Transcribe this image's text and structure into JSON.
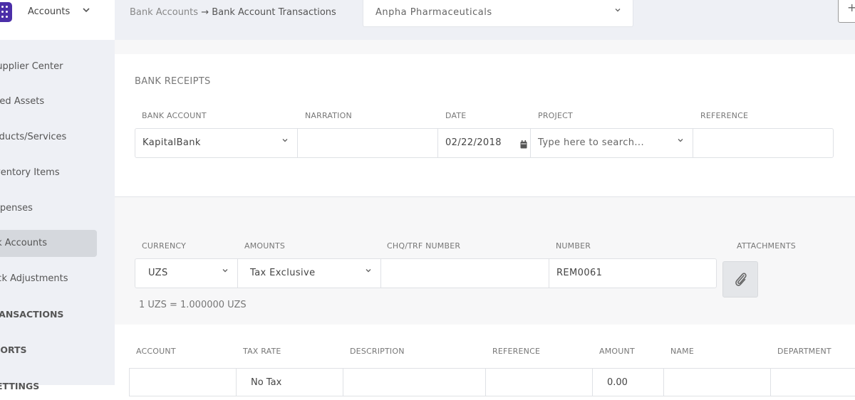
{
  "app": {
    "title": "Accounts"
  },
  "breadcrumb": {
    "parent": "Bank Accounts",
    "separator": "→",
    "current": "Bank Account Transactions"
  },
  "company": {
    "selected": "Anpha Pharmaceuticals"
  },
  "header": {
    "add_label": "+"
  },
  "sidebar": {
    "items": [
      {
        "label": "Supplier Center"
      },
      {
        "label": "Fixed Assets"
      },
      {
        "label": "Products/Services"
      },
      {
        "label": "Inventory Items"
      },
      {
        "label": "Expenses"
      },
      {
        "label": "Bank Accounts"
      },
      {
        "label": "Stock Adjustments"
      }
    ],
    "sections": [
      {
        "label": "TRANSACTIONS"
      },
      {
        "label": "REPORTS"
      },
      {
        "label": "SETTINGS"
      }
    ]
  },
  "receipts": {
    "title": "BANK RECEIPTS",
    "columns": {
      "bank_account": "BANK ACCOUNT",
      "narration": "NARRATION",
      "date": "DATE",
      "project": "PROJECT",
      "reference": "REFERENCE"
    },
    "bank_account": "KapitalBank",
    "narration": "",
    "date": "02/22/2018",
    "project_placeholder": "Type here to search...",
    "reference": ""
  },
  "details": {
    "columns": {
      "currency": "CURRENCY",
      "amounts": "AMOUNTS",
      "chq": "CHQ/TRF NUMBER",
      "number": "NUMBER",
      "attachments": "ATTACHMENTS"
    },
    "currency": "UZS",
    "amounts": "Tax Exclusive",
    "chq": "",
    "number": "REM0061",
    "rate_note": "1 UZS = 1.000000 UZS"
  },
  "lines": {
    "headers": [
      "ACCOUNT",
      "TAX RATE",
      "DESCRIPTION",
      "REFERENCE",
      "AMOUNT",
      "NAME",
      "DEPARTMENT"
    ],
    "row": {
      "account": "",
      "tax_rate": "No Tax",
      "description": "",
      "reference": "",
      "amount": "0.00",
      "name": "",
      "department": ""
    }
  },
  "icons": {
    "calendar": "calendar-icon",
    "attachment": "paperclip-icon",
    "chevron": "chevron-down-icon",
    "apps": "apps-grid-icon"
  },
  "colors": {
    "brand": "#4b2fa8",
    "sidebar_bg": "#eef0f5",
    "active_item": "#d5d8dd"
  }
}
